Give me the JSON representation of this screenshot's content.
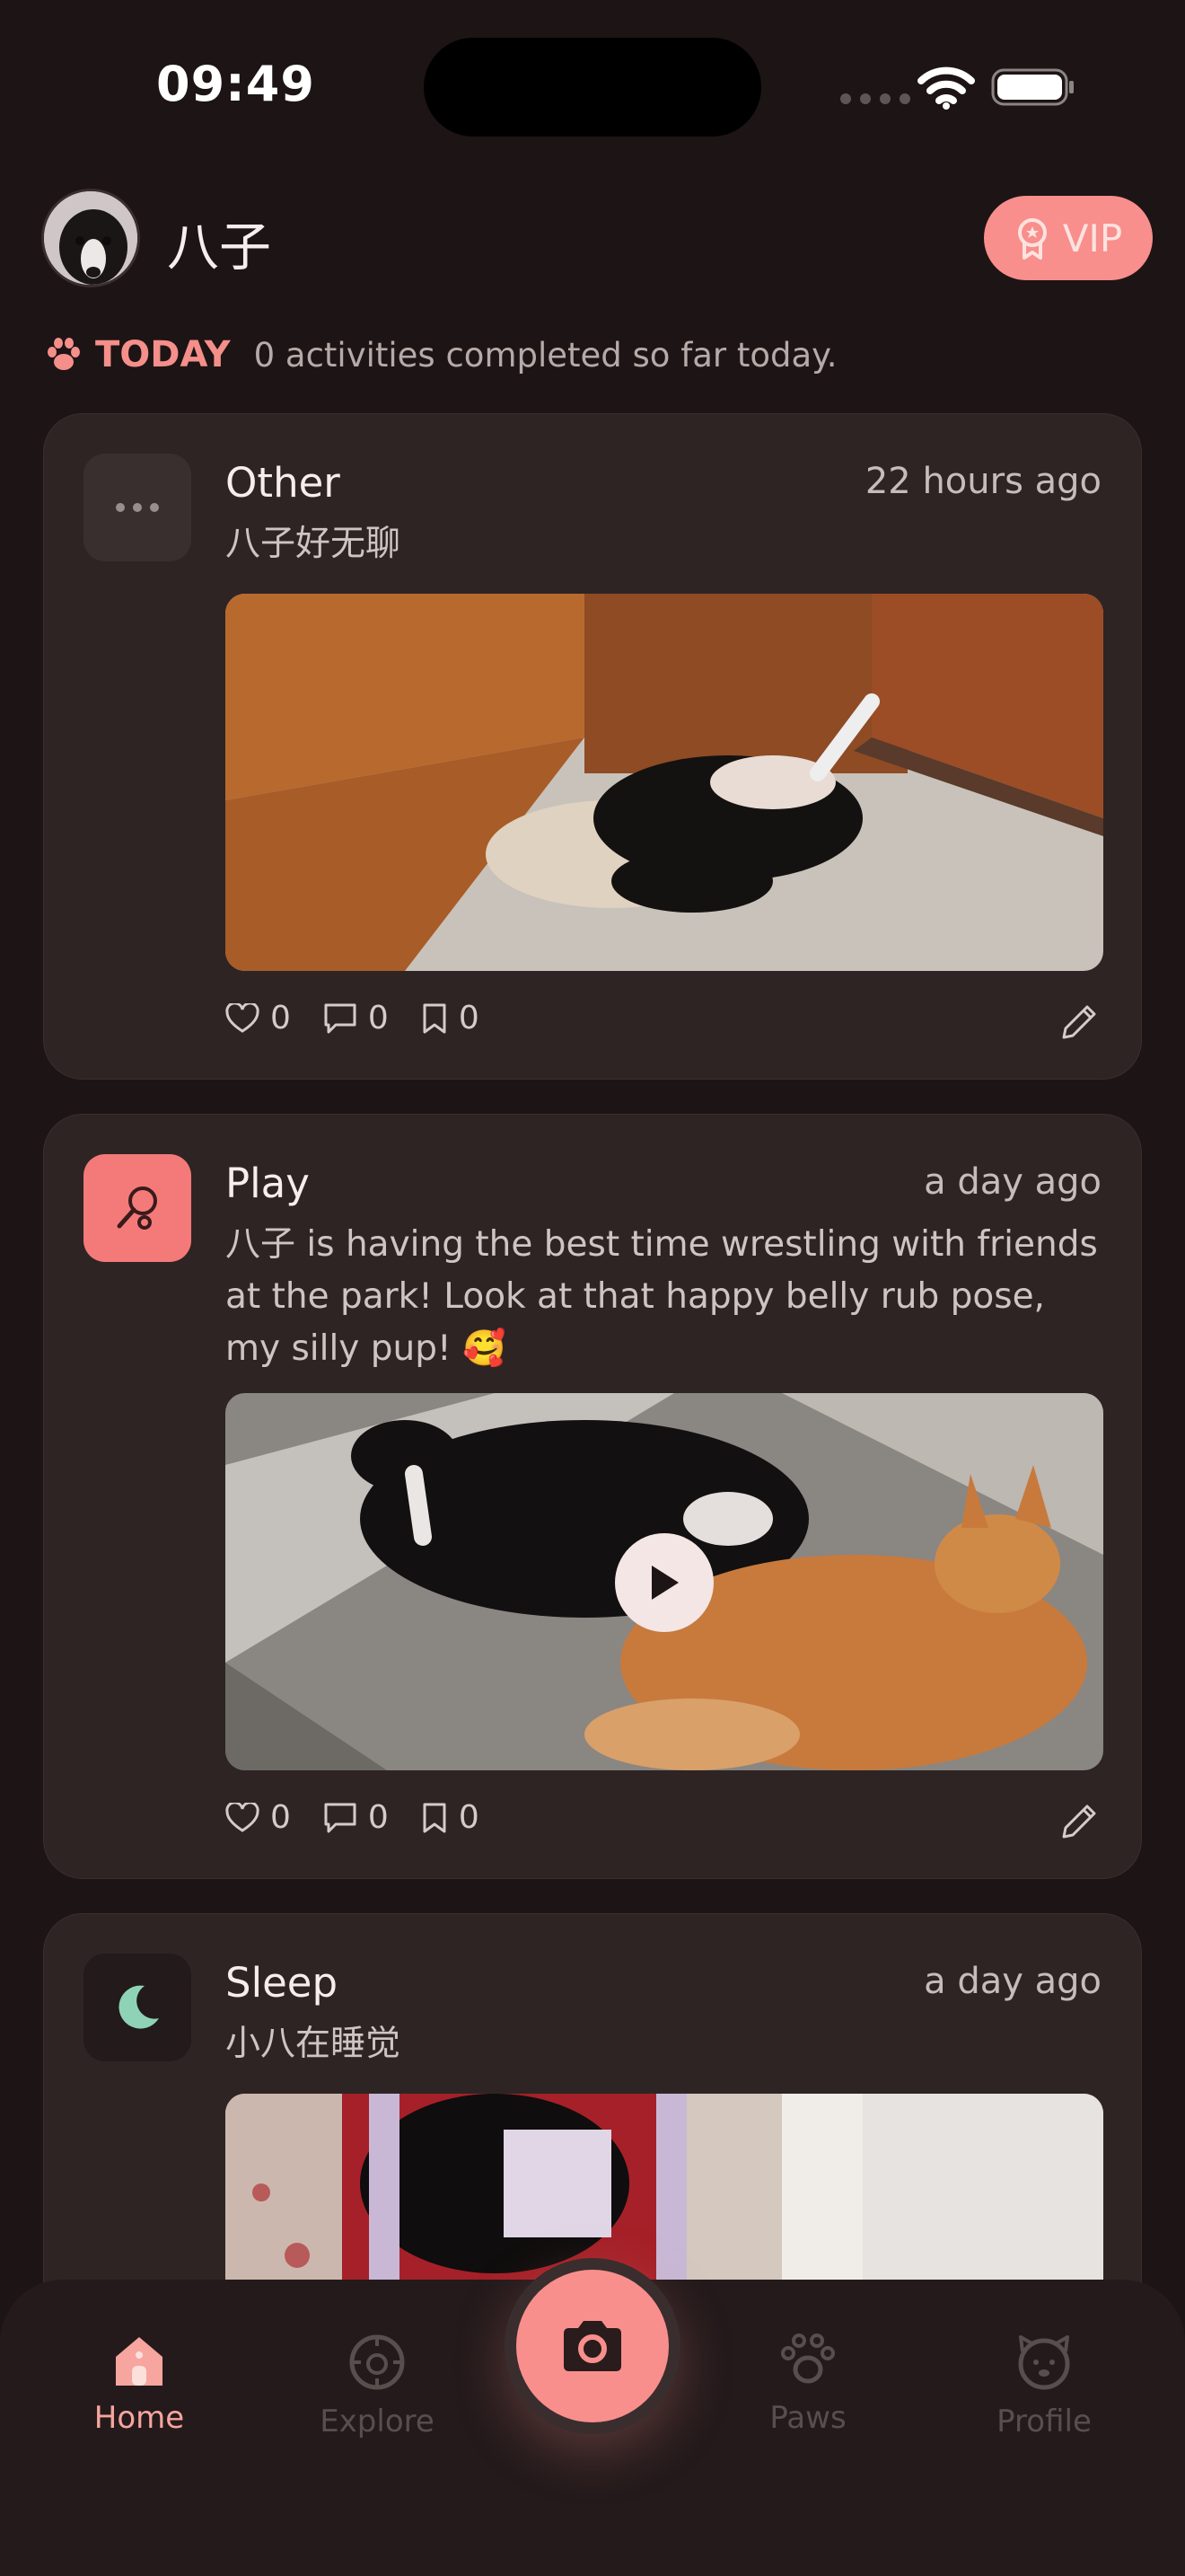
{
  "status_bar": {
    "time": "09:49"
  },
  "header": {
    "pet_name": "八子",
    "vip_label": "VIP"
  },
  "today": {
    "label": "TODAY",
    "text": "0 activities completed so far today."
  },
  "posts": [
    {
      "category": "Other",
      "time": "22 hours ago",
      "description": "八子好无聊",
      "media_type": "photo",
      "likes": "0",
      "comments": "0",
      "saves": "0",
      "icon": "more-dots-icon",
      "icon_bg": "#3a2f2f"
    },
    {
      "category": "Play",
      "time": "a day ago",
      "description": "八子 is having the best time wrestling with friends at the park! Look at that happy belly rub pose, my silly pup! 🥰",
      "media_type": "video",
      "likes": "0",
      "comments": "0",
      "saves": "0",
      "icon": "toy-racket-icon",
      "icon_bg": "#f47a79"
    },
    {
      "category": "Sleep",
      "time": "a day ago",
      "description": "小八在睡觉",
      "media_type": "photo",
      "icon": "moon-icon",
      "icon_bg": "#221a1b"
    }
  ],
  "nav": {
    "home": "Home",
    "explore": "Explore",
    "paws": "Paws",
    "profile": "Profile",
    "active": "home"
  },
  "colors": {
    "background": "#1d1415",
    "card": "#2e2424",
    "accent": "#f88f8c",
    "sleep_icon": "#8fd3b6"
  }
}
